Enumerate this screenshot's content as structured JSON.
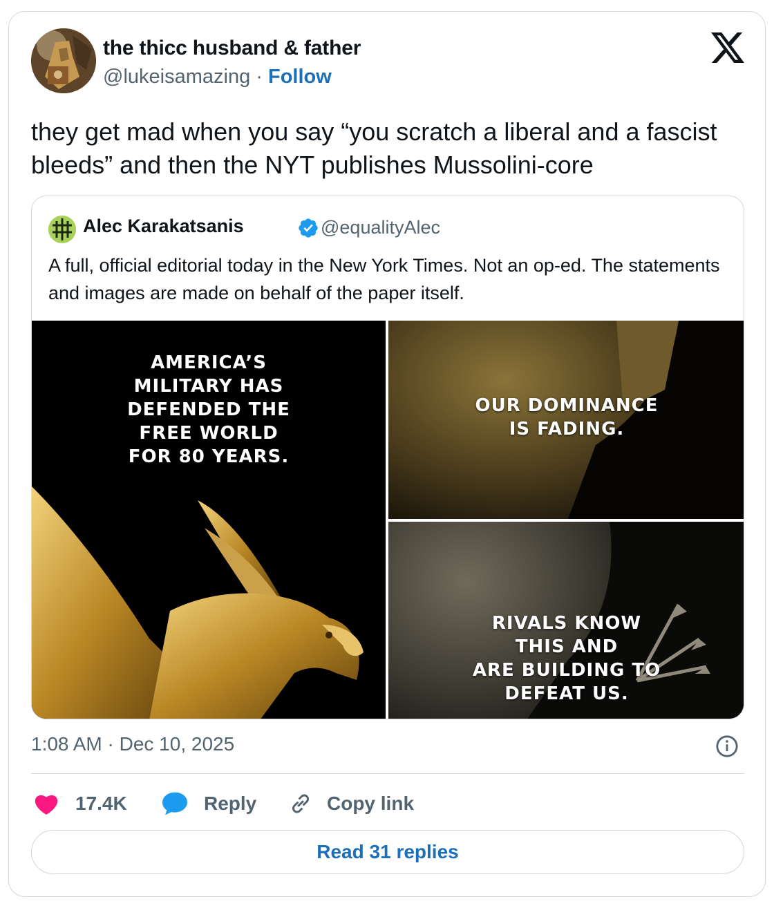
{
  "author": {
    "display_name": "the thicc husband & father",
    "handle": "@lukeisamazing",
    "separator": "·",
    "follow_label": "Follow"
  },
  "tweet": {
    "text": "they get mad when you say “you scratch a liberal and a fascist bleeds” and then the NYT publishes Mussolini-core"
  },
  "quoted_tweet": {
    "display_name": "Alec Karakatsanis",
    "handle": "@equalityAlec",
    "verified": true,
    "text": "A full, official editorial today in the New York Times. Not an op-ed. The statements and images are made on behalf of the paper itself.",
    "images": [
      {
        "caption": "AMERICA’S\nMILITARY HAS\nDEFENDED THE\nFREE WORLD\nFOR 80 YEARS."
      },
      {
        "caption": "OUR DOMINANCE\nIS FADING."
      },
      {
        "caption": "RIVALS KNOW\nTHIS AND\nARE BUILDING TO\nDEFEAT US."
      }
    ]
  },
  "meta": {
    "timestamp": "1:08 AM · Dec 10, 2025"
  },
  "actions": {
    "like_count": "17.4K",
    "reply_label": "Reply",
    "copy_link_label": "Copy link",
    "read_replies_label": "Read 31 replies"
  },
  "colors": {
    "like": "#f91880",
    "reply": "#1d9bf0",
    "link": "#1d6fb8",
    "border": "#cfd9de",
    "secondary_text": "#536471"
  },
  "icons": [
    "x-logo-icon",
    "verified-badge-icon",
    "info-icon",
    "heart-icon",
    "reply-bubble-icon",
    "link-icon"
  ]
}
